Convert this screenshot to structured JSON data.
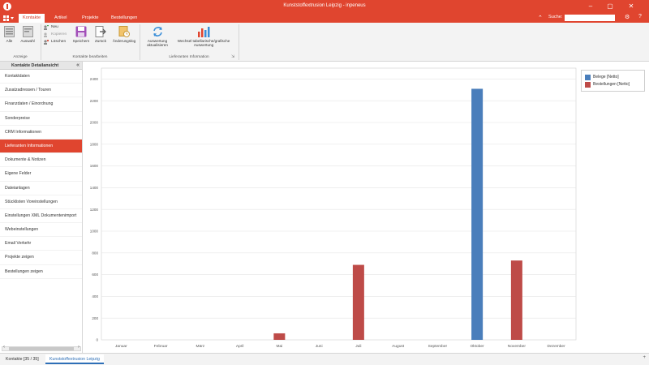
{
  "window": {
    "title": "Kunststoffextrusion Leipzig - inpeneus"
  },
  "tabs": [
    {
      "label": "Kontakte",
      "active": true
    },
    {
      "label": "Artikel",
      "active": false
    },
    {
      "label": "Projekte",
      "active": false
    },
    {
      "label": "Bestellungen",
      "active": false
    }
  ],
  "search": {
    "label": "Suche:",
    "value": "",
    "placeholder": ""
  },
  "ribbon": {
    "alle": "Alle",
    "auswahl": "Auswahl",
    "neu": "Neu",
    "kopieren": "Kopieren",
    "loeschen": "Löschen",
    "speichern": "Speichern",
    "zurueck": "Zurück",
    "aenderungslog": "Änderungslog",
    "auswertung_line1": "Auswertung",
    "auswertung_line2": "aktualisieren",
    "wechsel_line1": "Wechsel tabellarische/grafische",
    "wechsel_line2": "Auswertung",
    "group_anzeige": "Anzeige",
    "group_bearbeiten": "Kontakte bearbeiten",
    "group_lieferanten": "Lieferanten Information"
  },
  "sidebar": {
    "header": "Kontakte Detailansicht",
    "items": [
      {
        "label": "Kontaktdaten",
        "active": false
      },
      {
        "label": "Zusatzadressen / Touren",
        "active": false
      },
      {
        "label": "Finanzdaten / Einordnung",
        "active": false
      },
      {
        "label": "Sonderpreise",
        "active": false
      },
      {
        "label": "CRM Informationen",
        "active": false
      },
      {
        "label": "Lieferanten Informationen",
        "active": true
      },
      {
        "label": "Dokumente & Notizen",
        "active": false
      },
      {
        "label": "Eigene Felder",
        "active": false
      },
      {
        "label": "Dateianlagen",
        "active": false
      },
      {
        "label": "Stücklisten Voreinstellungen",
        "active": false
      },
      {
        "label": "Einstellungen XML Dokumentenimport",
        "active": false
      },
      {
        "label": "Webeinstellungen",
        "active": false
      },
      {
        "label": "Email Verkehr",
        "active": false
      },
      {
        "label": "Projekte zeigen",
        "active": false
      },
      {
        "label": "Bestellungen zeigen",
        "active": false
      }
    ]
  },
  "statusbar": {
    "tab1": "Kontakte [35 / 35]",
    "tab2": "Kunststoffextrusion Leipzig"
  },
  "colors": {
    "accent": "#e0452f",
    "belege": "#4a7ebb",
    "bestellungen": "#be4b48"
  },
  "chart_data": {
    "type": "bar",
    "categories": [
      "Januar",
      "Februar",
      "März",
      "April",
      "Mai",
      "Juni",
      "Juli",
      "August",
      "September",
      "Oktober",
      "November",
      "Dezember"
    ],
    "series": [
      {
        "name": "Belege [Netto]",
        "color": "#4a7ebb",
        "values": [
          0,
          0,
          0,
          0,
          0,
          0,
          0,
          0,
          0,
          2310,
          0,
          0
        ]
      },
      {
        "name": "Bestellungen [Netto]",
        "color": "#be4b48",
        "values": [
          0,
          0,
          0,
          0,
          60,
          0,
          690,
          0,
          0,
          0,
          730,
          0
        ]
      }
    ],
    "yticks": [
      0,
      200,
      400,
      600,
      800,
      1000,
      1200,
      1400,
      1600,
      1800,
      2000,
      2200,
      2400
    ],
    "ylim": [
      0,
      2500
    ],
    "grid": true,
    "legend": "top-right"
  }
}
